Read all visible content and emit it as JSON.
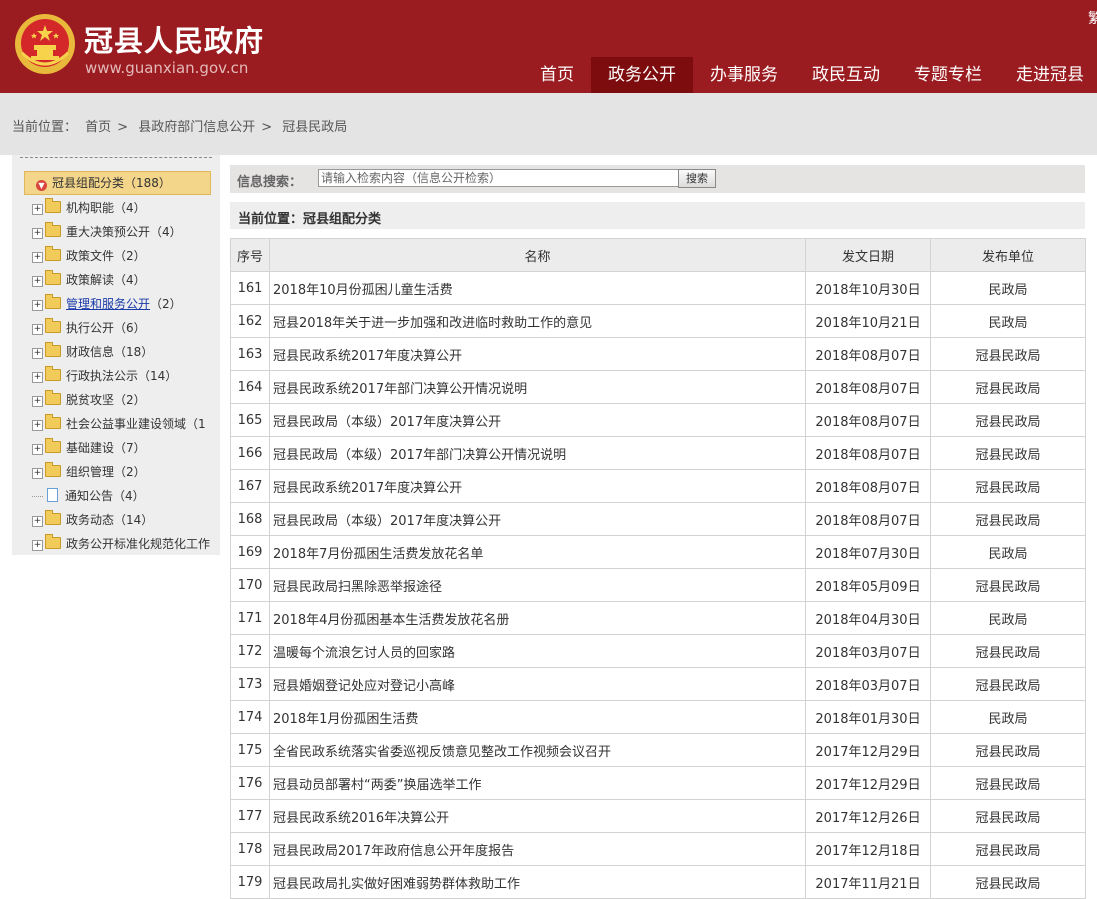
{
  "header": {
    "site_title": "冠县人民政府",
    "site_url": "www.guanxian.gov.cn",
    "corner_text": "繁",
    "nav": [
      {
        "label": "首页",
        "active": false
      },
      {
        "label": "政务公开",
        "active": true
      },
      {
        "label": "办事服务",
        "active": false
      },
      {
        "label": "政民互动",
        "active": false
      },
      {
        "label": "专题专栏",
        "active": false
      },
      {
        "label": "走进冠县",
        "active": false
      }
    ]
  },
  "breadcrumb": {
    "prefix": "当前位置：",
    "items": [
      "首页",
      "县政府部门信息公开",
      "冠县民政局"
    ],
    "separator": ">"
  },
  "sidebar": {
    "root_label": "冠县组配分类（188）",
    "items": [
      {
        "label": "机构职能（4）",
        "type": "folder"
      },
      {
        "label": "重大决策预公开（4）",
        "type": "folder"
      },
      {
        "label": "政策文件（2）",
        "type": "folder"
      },
      {
        "label": "政策解读（4）",
        "type": "folder"
      },
      {
        "label": "管理和服务公开",
        "count": "（2）",
        "type": "folder-link"
      },
      {
        "label": "执行公开（6）",
        "type": "folder"
      },
      {
        "label": "财政信息（18）",
        "type": "folder"
      },
      {
        "label": "行政执法公示（14）",
        "type": "folder"
      },
      {
        "label": "脱贫攻坚（2）",
        "type": "folder"
      },
      {
        "label": "社会公益事业建设领域（1",
        "type": "folder"
      },
      {
        "label": "基础建设（7）",
        "type": "folder"
      },
      {
        "label": "组织管理（2）",
        "type": "folder"
      },
      {
        "label": "通知公告（4）",
        "type": "doc"
      },
      {
        "label": "政务动态（14）",
        "type": "folder"
      },
      {
        "label": "政务公开标准化规范化工作",
        "type": "folder"
      }
    ]
  },
  "search": {
    "label": "信息搜索：",
    "placeholder": "请输入检索内容（信息公开检索）",
    "button": "搜索"
  },
  "location": {
    "text": "当前位置：冠县组配分类"
  },
  "table": {
    "headers": [
      "序号",
      "名称",
      "发文日期",
      "发布单位"
    ],
    "rows": [
      [
        "161",
        "2018年10月份孤困儿童生活费",
        "2018年10月30日",
        "民政局"
      ],
      [
        "162",
        "冠县2018年关于进一步加强和改进临时救助工作的意见",
        "2018年10月21日",
        "民政局"
      ],
      [
        "163",
        "冠县民政系统2017年度决算公开",
        "2018年08月07日",
        "冠县民政局"
      ],
      [
        "164",
        "冠县民政系统2017年部门决算公开情况说明",
        "2018年08月07日",
        "冠县民政局"
      ],
      [
        "165",
        "冠县民政局（本级）2017年度决算公开",
        "2018年08月07日",
        "冠县民政局"
      ],
      [
        "166",
        "冠县民政局（本级）2017年部门决算公开情况说明",
        "2018年08月07日",
        "冠县民政局"
      ],
      [
        "167",
        "冠县民政系统2017年度决算公开",
        "2018年08月07日",
        "冠县民政局"
      ],
      [
        "168",
        "冠县民政局（本级）2017年度决算公开",
        "2018年08月07日",
        "冠县民政局"
      ],
      [
        "169",
        "2018年7月份孤困生活费发放花名单",
        "2018年07月30日",
        "民政局"
      ],
      [
        "170",
        "冠县民政局扫黑除恶举报途径",
        "2018年05月09日",
        "冠县民政局"
      ],
      [
        "171",
        "2018年4月份孤困基本生活费发放花名册",
        "2018年04月30日",
        "民政局"
      ],
      [
        "172",
        "温暖每个流浪乞讨人员的回家路",
        "2018年03月07日",
        "冠县民政局"
      ],
      [
        "173",
        "冠县婚姻登记处应对登记小高峰",
        "2018年03月07日",
        "冠县民政局"
      ],
      [
        "174",
        "2018年1月份孤困生活费",
        "2018年01月30日",
        "民政局"
      ],
      [
        "175",
        "全省民政系统落实省委巡视反馈意见整改工作视频会议召开",
        "2017年12月29日",
        "冠县民政局"
      ],
      [
        "176",
        "冠县动员部署村“两委”换届选举工作",
        "2017年12月29日",
        "冠县民政局"
      ],
      [
        "177",
        "冠县民政系统2016年决算公开",
        "2017年12月26日",
        "冠县民政局"
      ],
      [
        "178",
        "冠县民政局2017年政府信息公开年度报告",
        "2017年12月18日",
        "冠县民政局"
      ],
      [
        "179",
        "冠县民政局扎实做好困难弱势群体救助工作",
        "2017年11月21日",
        "冠县民政局"
      ]
    ]
  },
  "colors": {
    "header_red": "#9b1c20",
    "nav_active": "#7d0c0e",
    "tree_root_bg": "#f4d68a",
    "link_blue": "#1a3aa8"
  }
}
